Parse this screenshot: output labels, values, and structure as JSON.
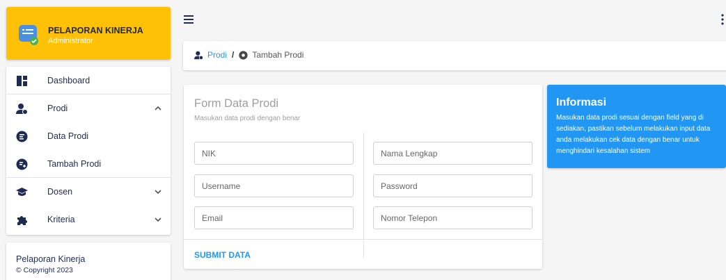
{
  "brand": {
    "title": "PELAPORAN KINERJA",
    "subtitle": "Administrator",
    "icon": "app-check-icon"
  },
  "colors": {
    "brand_bg": "#ffc107",
    "accent": "#2196f3",
    "nav_text": "#1d2b55",
    "info_bg": "#2196f3"
  },
  "sidebar": {
    "items": [
      {
        "label": "Dashboard",
        "icon": "dashboard-icon",
        "chevron": ""
      },
      {
        "label": "Prodi",
        "icon": "user-settings-icon",
        "chevron": "up"
      },
      {
        "label": "Data Prodi",
        "icon": "list-circle-icon",
        "chevron": ""
      },
      {
        "label": "Tambah Prodi",
        "icon": "add-circle-icon",
        "chevron": ""
      },
      {
        "label": "Dosen",
        "icon": "graduation-cap-icon",
        "chevron": "down"
      },
      {
        "label": "Kriteria",
        "icon": "puzzle-icon",
        "chevron": "down"
      }
    ]
  },
  "footer": {
    "title": "Pelaporan Kinerja",
    "copyright": "© Copyright 2023"
  },
  "breadcrumb": {
    "parent": "Prodi",
    "separator": "/",
    "current": "Tambah Prodi"
  },
  "form": {
    "title": "Form Data Prodi",
    "subtitle": "Masukan data prodi dengan benar",
    "fields": {
      "nik": {
        "placeholder": "NIK",
        "value": ""
      },
      "nama_lengkap": {
        "placeholder": "Nama Lengkap",
        "value": ""
      },
      "username": {
        "placeholder": "Username",
        "value": ""
      },
      "password": {
        "placeholder": "Password",
        "value": ""
      },
      "email": {
        "placeholder": "Email",
        "value": ""
      },
      "nomor_telepon": {
        "placeholder": "Nomor Telepon",
        "value": ""
      }
    },
    "submit_label": "SUBMIT DATA"
  },
  "info": {
    "title": "Informasi",
    "text": "Masukan data prodi sesuai dengan field yang di sediakan, pastikan sebelum melakukan input data anda melakukan cek data dengan benar untuk menghindari kesalahan sistem"
  }
}
